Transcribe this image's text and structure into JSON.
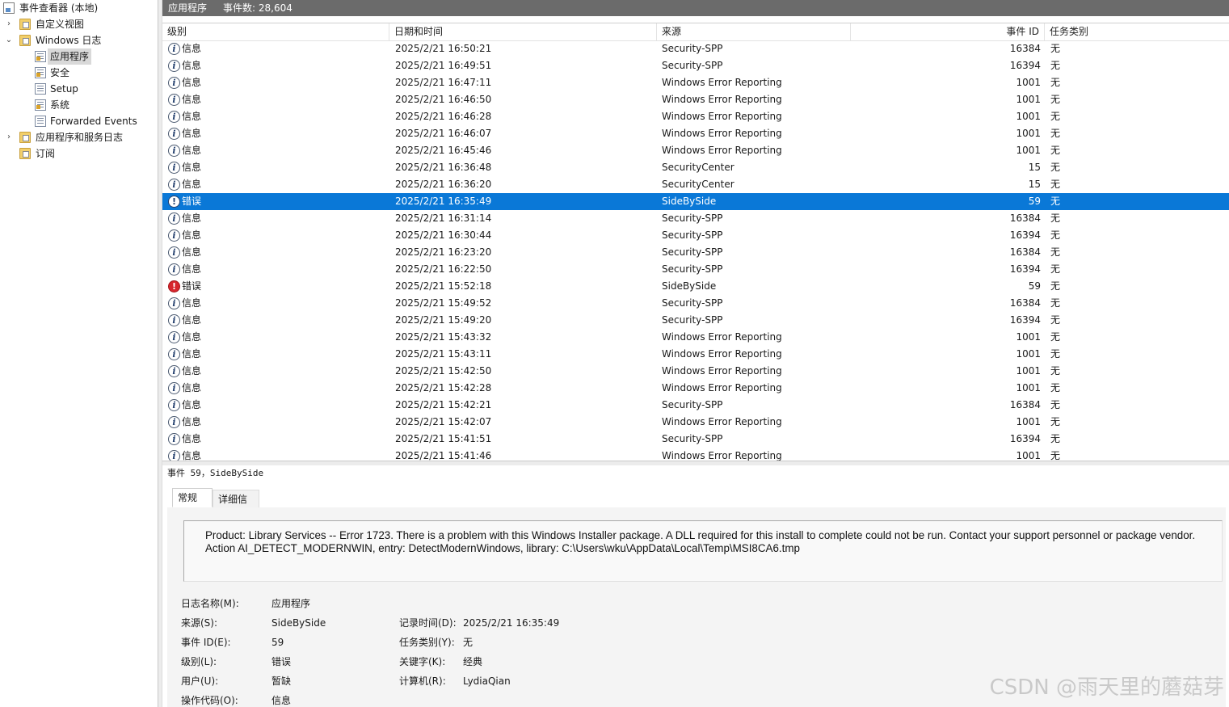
{
  "tree": {
    "root_label": "事件查看器 (本地)",
    "items": [
      {
        "label": "自定义视图"
      },
      {
        "label": "Windows 日志"
      },
      {
        "label": "应用程序"
      },
      {
        "label": "安全"
      },
      {
        "label": "Setup"
      },
      {
        "label": "系统"
      },
      {
        "label": "Forwarded Events"
      },
      {
        "label": "应用程序和服务日志"
      },
      {
        "label": "订阅"
      }
    ]
  },
  "header": {
    "log_name": "应用程序",
    "event_count": "事件数: 28,604"
  },
  "grid": {
    "columns": [
      "级别",
      "日期和时间",
      "来源",
      "事件 ID",
      "任务类别"
    ],
    "rows": [
      {
        "level": "信息",
        "type": "info",
        "datetime": "2025/2/21 16:50:21",
        "source": "Security-SPP",
        "event_id": "16384",
        "task": "无"
      },
      {
        "level": "信息",
        "type": "info",
        "datetime": "2025/2/21 16:49:51",
        "source": "Security-SPP",
        "event_id": "16394",
        "task": "无"
      },
      {
        "level": "信息",
        "type": "info",
        "datetime": "2025/2/21 16:47:11",
        "source": "Windows Error Reporting",
        "event_id": "1001",
        "task": "无"
      },
      {
        "level": "信息",
        "type": "info",
        "datetime": "2025/2/21 16:46:50",
        "source": "Windows Error Reporting",
        "event_id": "1001",
        "task": "无"
      },
      {
        "level": "信息",
        "type": "info",
        "datetime": "2025/2/21 16:46:28",
        "source": "Windows Error Reporting",
        "event_id": "1001",
        "task": "无"
      },
      {
        "level": "信息",
        "type": "info",
        "datetime": "2025/2/21 16:46:07",
        "source": "Windows Error Reporting",
        "event_id": "1001",
        "task": "无"
      },
      {
        "level": "信息",
        "type": "info",
        "datetime": "2025/2/21 16:45:46",
        "source": "Windows Error Reporting",
        "event_id": "1001",
        "task": "无"
      },
      {
        "level": "信息",
        "type": "info",
        "datetime": "2025/2/21 16:36:48",
        "source": "SecurityCenter",
        "event_id": "15",
        "task": "无"
      },
      {
        "level": "信息",
        "type": "info",
        "datetime": "2025/2/21 16:36:20",
        "source": "SecurityCenter",
        "event_id": "15",
        "task": "无"
      },
      {
        "level": "错误",
        "type": "error",
        "selected": true,
        "datetime": "2025/2/21 16:35:49",
        "source": "SideBySide",
        "event_id": "59",
        "task": "无"
      },
      {
        "level": "信息",
        "type": "info",
        "datetime": "2025/2/21 16:31:14",
        "source": "Security-SPP",
        "event_id": "16384",
        "task": "无"
      },
      {
        "level": "信息",
        "type": "info",
        "datetime": "2025/2/21 16:30:44",
        "source": "Security-SPP",
        "event_id": "16394",
        "task": "无"
      },
      {
        "level": "信息",
        "type": "info",
        "datetime": "2025/2/21 16:23:20",
        "source": "Security-SPP",
        "event_id": "16384",
        "task": "无"
      },
      {
        "level": "信息",
        "type": "info",
        "datetime": "2025/2/21 16:22:50",
        "source": "Security-SPP",
        "event_id": "16394",
        "task": "无"
      },
      {
        "level": "错误",
        "type": "error",
        "datetime": "2025/2/21 15:52:18",
        "source": "SideBySide",
        "event_id": "59",
        "task": "无"
      },
      {
        "level": "信息",
        "type": "info",
        "datetime": "2025/2/21 15:49:52",
        "source": "Security-SPP",
        "event_id": "16384",
        "task": "无"
      },
      {
        "level": "信息",
        "type": "info",
        "datetime": "2025/2/21 15:49:20",
        "source": "Security-SPP",
        "event_id": "16394",
        "task": "无"
      },
      {
        "level": "信息",
        "type": "info",
        "datetime": "2025/2/21 15:43:32",
        "source": "Windows Error Reporting",
        "event_id": "1001",
        "task": "无"
      },
      {
        "level": "信息",
        "type": "info",
        "datetime": "2025/2/21 15:43:11",
        "source": "Windows Error Reporting",
        "event_id": "1001",
        "task": "无"
      },
      {
        "level": "信息",
        "type": "info",
        "datetime": "2025/2/21 15:42:50",
        "source": "Windows Error Reporting",
        "event_id": "1001",
        "task": "无"
      },
      {
        "level": "信息",
        "type": "info",
        "datetime": "2025/2/21 15:42:28",
        "source": "Windows Error Reporting",
        "event_id": "1001",
        "task": "无"
      },
      {
        "level": "信息",
        "type": "info",
        "datetime": "2025/2/21 15:42:21",
        "source": "Security-SPP",
        "event_id": "16384",
        "task": "无"
      },
      {
        "level": "信息",
        "type": "info",
        "datetime": "2025/2/21 15:42:07",
        "source": "Windows Error Reporting",
        "event_id": "1001",
        "task": "无"
      },
      {
        "level": "信息",
        "type": "info",
        "datetime": "2025/2/21 15:41:51",
        "source": "Security-SPP",
        "event_id": "16394",
        "task": "无"
      },
      {
        "level": "信息",
        "type": "info",
        "datetime": "2025/2/21 15:41:46",
        "source": "Windows Error Reporting",
        "event_id": "1001",
        "task": "无"
      }
    ]
  },
  "detail": {
    "title": "事件 59，SideBySide",
    "tabs": [
      "常规",
      "详细信息"
    ],
    "message": "Product: Library Services -- Error 1723. There is a problem with this Windows Installer package. A DLL required for this install to complete could not be run. Contact your support personnel or package vendor.  Action AI_DETECT_MODERNWIN, entry: DetectModernWindows, library: C:\\Users\\wku\\AppData\\Local\\Temp\\MSI8CA6.tmp",
    "props": {
      "log_name_label": "日志名称(M):",
      "log_name": "应用程序",
      "source_label": "来源(S):",
      "source": "SideBySide",
      "logged_label": "记录时间(D):",
      "logged": "2025/2/21 16:35:49",
      "event_id_label": "事件 ID(E):",
      "event_id": "59",
      "task_label": "任务类别(Y):",
      "task": "无",
      "level_label": "级别(L):",
      "level": "错误",
      "keywords_label": "关键字(K):",
      "keywords": "经典",
      "user_label": "用户(U):",
      "user": "暂缺",
      "computer_label": "计算机(R):",
      "computer": "LydiaQian",
      "opcode_label": "操作代码(O):",
      "opcode": "信息"
    }
  },
  "watermark": "CSDN @雨天里的蘑菇芽",
  "colors": {
    "selection": "#0a78d7",
    "error": "#d7262d",
    "title_bar": "#6b6b6b"
  }
}
